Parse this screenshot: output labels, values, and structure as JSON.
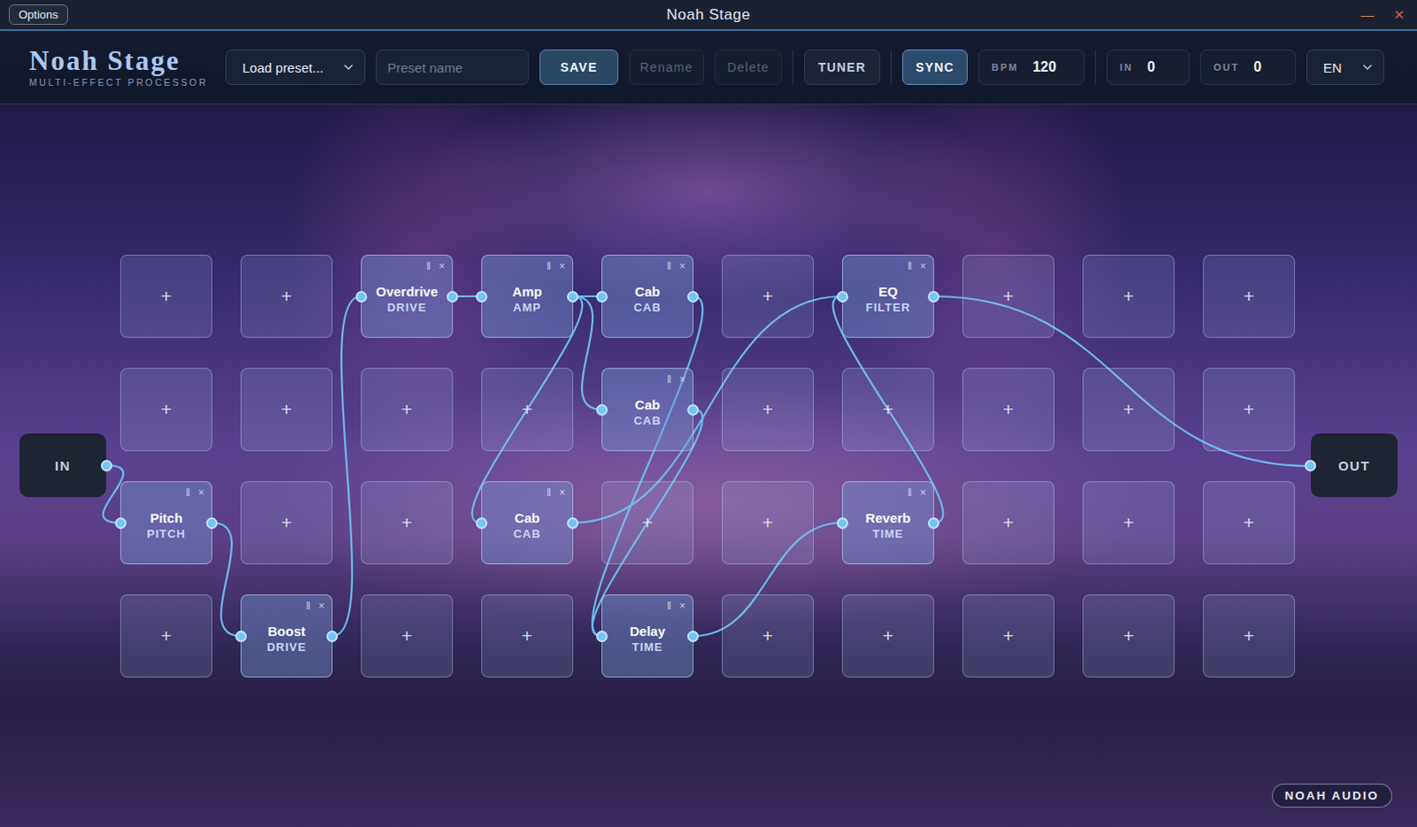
{
  "window": {
    "title": "Noah Stage",
    "options": "Options",
    "minimize": "—",
    "close": "✕"
  },
  "logo": {
    "title": "Noah Stage",
    "subtitle": "MULTI-EFFECT PROCESSOR"
  },
  "toolbar": {
    "preset_select": {
      "value": "Load preset...",
      "open": false
    },
    "preset_name": {
      "placeholder": "Preset name",
      "value": ""
    },
    "buttons": [
      {
        "label": "SAVE",
        "disabled": false
      },
      {
        "label": "Rename",
        "disabled": true
      },
      {
        "label": "Delete",
        "disabled": true
      }
    ],
    "tuner": {
      "label": "TUNER",
      "on": false
    },
    "sync": {
      "label": "SYNC",
      "on": true
    },
    "bpm": {
      "label": "BPM",
      "value": "120"
    },
    "meters": [
      {
        "label": "IN",
        "value": "0"
      },
      {
        "label": "OUT",
        "value": "0"
      }
    ],
    "language": {
      "value": "EN",
      "open": false
    }
  },
  "stage": {
    "input": {
      "label": "IN"
    },
    "output": {
      "label": "OUT"
    },
    "slots": [
      [
        {
          "kind": "empty",
          "label": "+"
        },
        {
          "kind": "empty",
          "label": "+"
        },
        {
          "kind": "module",
          "name": "Overdrive",
          "type": "DRIVE",
          "handle": "‖",
          "close": "×"
        },
        {
          "kind": "module",
          "name": "Amp",
          "type": "AMP",
          "handle": "‖",
          "close": "×"
        },
        {
          "kind": "module",
          "name": "Cab",
          "type": "CAB",
          "handle": "‖",
          "close": "×"
        },
        {
          "kind": "empty",
          "label": "+"
        },
        {
          "kind": "module",
          "name": "EQ",
          "type": "FILTER",
          "handle": "‖",
          "close": "×"
        },
        {
          "kind": "empty",
          "label": "+"
        },
        {
          "kind": "empty",
          "label": "+"
        },
        {
          "kind": "empty",
          "label": "+"
        }
      ],
      [
        {
          "kind": "empty",
          "label": "+"
        },
        {
          "kind": "empty",
          "label": "+"
        },
        {
          "kind": "empty",
          "label": "+"
        },
        {
          "kind": "empty",
          "label": "+"
        },
        {
          "kind": "module",
          "name": "Cab",
          "type": "CAB",
          "handle": "‖",
          "close": "×"
        },
        {
          "kind": "empty",
          "label": "+"
        },
        {
          "kind": "empty",
          "label": "+"
        },
        {
          "kind": "empty",
          "label": "+"
        },
        {
          "kind": "empty",
          "label": "+"
        },
        {
          "kind": "empty",
          "label": "+"
        }
      ],
      [
        {
          "kind": "module",
          "name": "Pitch",
          "type": "PITCH",
          "handle": "‖",
          "close": "×"
        },
        {
          "kind": "empty",
          "label": "+"
        },
        {
          "kind": "empty",
          "label": "+"
        },
        {
          "kind": "module",
          "name": "Cab",
          "type": "CAB",
          "handle": "‖",
          "close": "×"
        },
        {
          "kind": "empty",
          "label": "+"
        },
        {
          "kind": "empty",
          "label": "+"
        },
        {
          "kind": "module",
          "name": "Reverb",
          "type": "TIME",
          "handle": "‖",
          "close": "×"
        },
        {
          "kind": "empty",
          "label": "+"
        },
        {
          "kind": "empty",
          "label": "+"
        },
        {
          "kind": "empty",
          "label": "+"
        }
      ],
      [
        {
          "kind": "empty",
          "label": "+"
        },
        {
          "kind": "module",
          "name": "Boost",
          "type": "DRIVE",
          "handle": "‖",
          "close": "×"
        },
        {
          "kind": "empty",
          "label": "+"
        },
        {
          "kind": "empty",
          "label": "+"
        },
        {
          "kind": "module",
          "name": "Delay",
          "type": "TIME",
          "handle": "‖",
          "close": "×"
        },
        {
          "kind": "empty",
          "label": "+"
        },
        {
          "kind": "empty",
          "label": "+"
        },
        {
          "kind": "empty",
          "label": "+"
        },
        {
          "kind": "empty",
          "label": "+"
        },
        {
          "kind": "empty",
          "label": "+"
        }
      ]
    ],
    "cables": [
      {
        "from": "in",
        "to": "r2c0"
      },
      {
        "from": "r2c0",
        "to": "r3c1"
      },
      {
        "from": "r3c1",
        "to": "r0c2"
      },
      {
        "from": "r0c2",
        "to": "r0c3"
      },
      {
        "from": "r0c3",
        "to": "r0c4"
      },
      {
        "from": "r0c3",
        "to": "r1c4"
      },
      {
        "from": "r0c3",
        "to": "r2c3"
      },
      {
        "from": "r0c4",
        "to": "r3c4"
      },
      {
        "from": "r1c4",
        "to": "r3c4"
      },
      {
        "from": "r2c3",
        "to": "r0c6"
      },
      {
        "from": "r3c4",
        "to": "r2c6"
      },
      {
        "from": "r2c6",
        "to": "r0c6"
      },
      {
        "from": "r0c6",
        "to": "out"
      }
    ]
  },
  "badge": "NOAH AUDIO"
}
